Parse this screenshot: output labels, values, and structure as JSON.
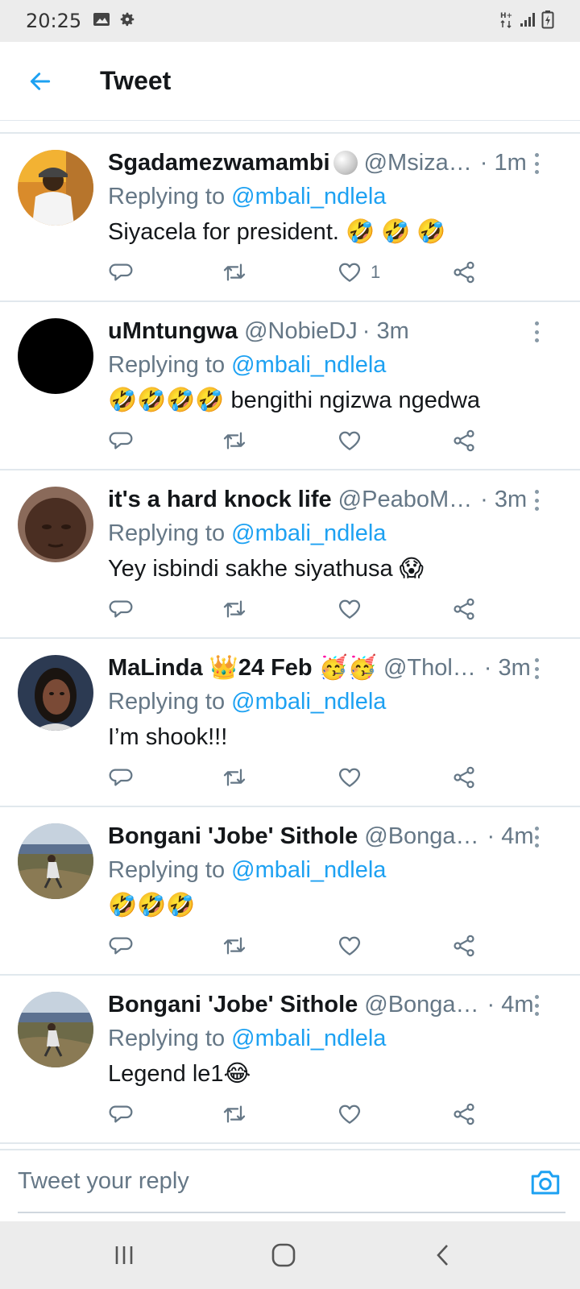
{
  "status_bar": {
    "time": "20:25"
  },
  "header": {
    "title": "Tweet"
  },
  "reply": {
    "placeholder": "Tweet your reply"
  },
  "tweets": [
    {
      "name": "Sgadamezwamambi",
      "handle": "@Msiza…",
      "time": "· 1m",
      "replying_prefix": "Replying to ",
      "replying_to": "@mbali_ndlela",
      "text": "Siyacela for president. 🤣 🤣 🤣",
      "like_count": "1"
    },
    {
      "name": "uMntungwa",
      "handle": "@NobieDJ",
      "time": "· 3m",
      "replying_prefix": "Replying to ",
      "replying_to": "@mbali_ndlela",
      "text": "🤣🤣🤣🤣 bengithi ngizwa ngedwa",
      "like_count": ""
    },
    {
      "name": "it's a hard knock life",
      "handle": "@PeaboM…",
      "time": "· 3m",
      "replying_prefix": "Replying to ",
      "replying_to": "@mbali_ndlela",
      "text": "Yey isbindi sakhe siyathusa 😱",
      "like_count": ""
    },
    {
      "name": "MaLinda 👑24 Feb 🥳🥳",
      "handle": "@Thol…",
      "time": "· 3m",
      "replying_prefix": "Replying to ",
      "replying_to": "@mbali_ndlela",
      "text": "I’m shook!!!",
      "like_count": ""
    },
    {
      "name": "Bongani 'Jobe' Sithole",
      "handle": "@Bonga…",
      "time": "· 4m",
      "replying_prefix": "Replying to ",
      "replying_to": "@mbali_ndlela",
      "text": "🤣🤣🤣",
      "like_count": ""
    },
    {
      "name": "Bongani 'Jobe' Sithole",
      "handle": "@Bonga…",
      "time": "· 4m",
      "replying_prefix": "Replying to ",
      "replying_to": "@mbali_ndlela",
      "text": "Legend le1😂",
      "like_count": ""
    }
  ],
  "colors": {
    "accent": "#1da1f2",
    "secondary_text": "#657786",
    "divider": "#e1e8ed"
  },
  "icons": [
    "arrow-left-icon",
    "reply-icon",
    "retweet-icon",
    "heart-icon",
    "share-icon",
    "more-icon",
    "camera-icon"
  ]
}
